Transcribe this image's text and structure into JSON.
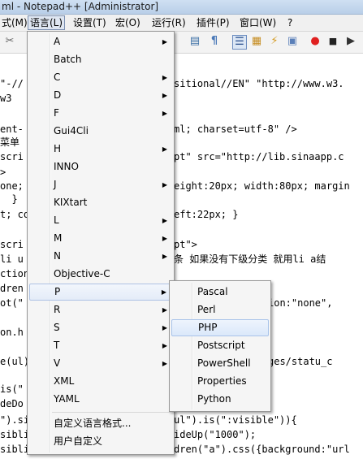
{
  "window": {
    "title": "ml - Notepad++ [Administrator]"
  },
  "menubar": [
    {
      "label": "式(M)"
    },
    {
      "label": "语言(L)"
    },
    {
      "label": "设置(T)"
    },
    {
      "label": "宏(O)"
    },
    {
      "label": "运行(R)"
    },
    {
      "label": "插件(P)"
    },
    {
      "label": "窗口(W)"
    },
    {
      "label": "?"
    }
  ],
  "toolbar": {
    "icons": [
      "scissors-icon",
      "copy-icon",
      "paste-icon",
      "undo-icon",
      "redo-icon",
      "find-icon",
      "replace-icon",
      "zoom-in-icon",
      "zoom-out-icon",
      "wrap-icon",
      "show-all-chars-icon",
      "indent-guide-icon",
      "document-map-icon",
      "function-list-icon",
      "macro-record-icon",
      "macro-stop-icon",
      "macro-play-icon"
    ]
  },
  "editor": {
    "lines": [
      "\"-//",
      "w3",
      "",
      "ent-",
      "菜单",
      "scri",
      ">",
      "one;",
      "  }",
      "t; co",
      "",
      "scri",
      "li u",
      "ction",
      "dren",
      "ot(\"",
      "",
      "on.h",
      "",
      "e(ul)",
      "",
      "is(\"",
      "deDo",
      "\").si",
      "sibli",
      "sibli"
    ],
    "right_fragments": [
      "sitional//EN\" \"http://www.w3.",
      "",
      "",
      "ml; charset=utf-8\" />",
      "",
      "pt\" src=\"http://lib.sinaapp.c",
      "",
      "eight:20px; width:80px; margin",
      "",
      "eft:22px; }",
      "",
      "pt\">",
      "条 如果没有下级分类 就用li a结",
      "",
      "",
      "ion:\"none\",",
      "",
      "",
      "",
      "ges/statu_c",
      "",
      "",
      "",
      "ul\").is(\":visible\")){",
      "ideUp(\"1000\");",
      "dren(\"a\").css({background:\"url"
    ]
  },
  "language_menu": {
    "items": [
      {
        "label": "A",
        "submenu": true
      },
      {
        "label": "Batch",
        "submenu": false
      },
      {
        "label": "C",
        "submenu": true
      },
      {
        "label": "D",
        "submenu": true
      },
      {
        "label": "F",
        "submenu": true
      },
      {
        "label": "Gui4Cli",
        "submenu": false
      },
      {
        "label": "H",
        "submenu": true
      },
      {
        "label": "INNO",
        "submenu": false
      },
      {
        "label": "J",
        "submenu": true
      },
      {
        "label": "KIXtart",
        "submenu": false
      },
      {
        "label": "L",
        "submenu": true
      },
      {
        "label": "M",
        "submenu": true
      },
      {
        "label": "N",
        "submenu": true
      },
      {
        "label": "Objective-C",
        "submenu": false
      },
      {
        "label": "P",
        "submenu": true
      },
      {
        "label": "R",
        "submenu": true
      },
      {
        "label": "S",
        "submenu": true
      },
      {
        "label": "T",
        "submenu": true
      },
      {
        "label": "V",
        "submenu": true
      },
      {
        "label": "XML",
        "submenu": false
      },
      {
        "label": "YAML",
        "submenu": false
      }
    ],
    "footer": [
      {
        "label": "自定义语言格式..."
      },
      {
        "label": "用户自定义"
      }
    ]
  },
  "p_submenu": {
    "items": [
      {
        "label": "Pascal"
      },
      {
        "label": "Perl"
      },
      {
        "label": "PHP"
      },
      {
        "label": "Postscript"
      },
      {
        "label": "PowerShell"
      },
      {
        "label": "Properties"
      },
      {
        "label": "Python"
      }
    ]
  },
  "colors": {
    "highlight_border": "#a8c3ea",
    "menu_bg": "#f5f5f5"
  }
}
